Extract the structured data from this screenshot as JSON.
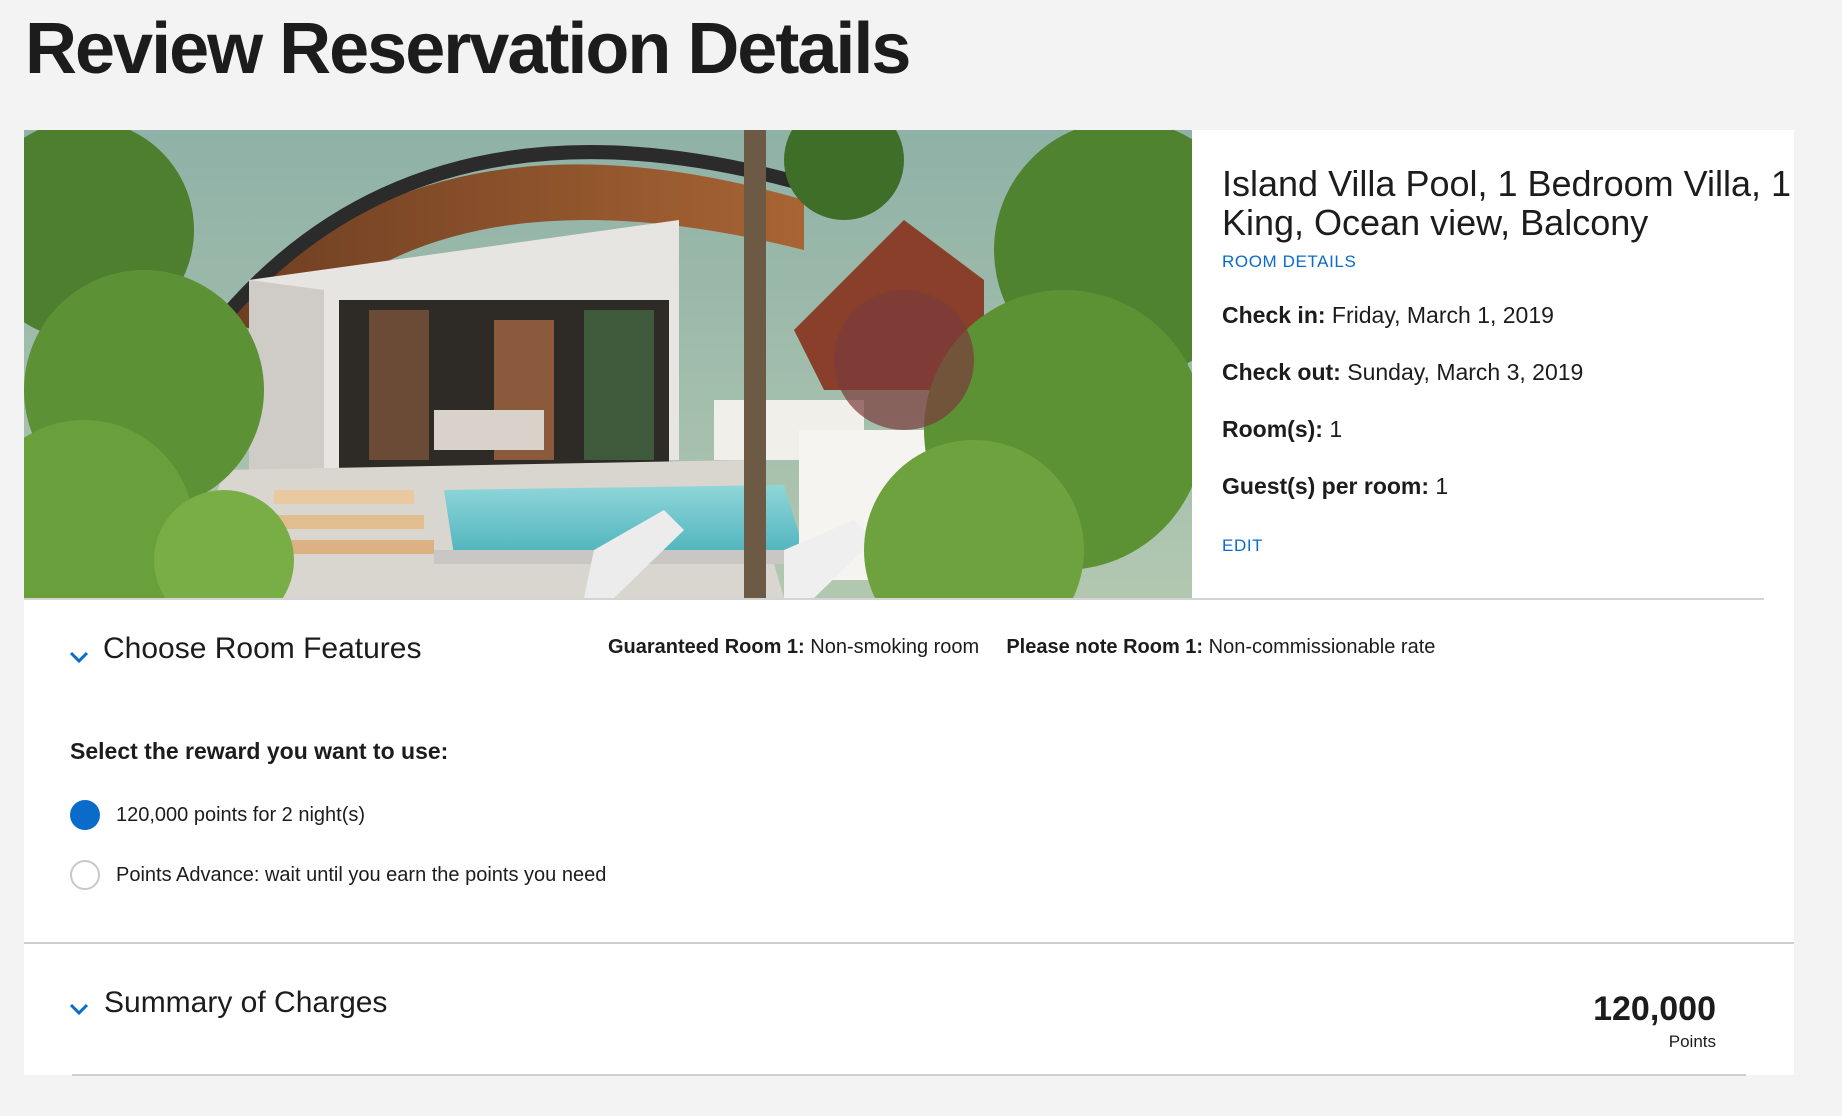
{
  "page": {
    "title": "Review Reservation Details"
  },
  "room": {
    "name": "Island Villa Pool, 1 Bedroom Villa, 1 King, Ocean view, Balcony",
    "room_details_link": "ROOM DETAILS",
    "check_in_label": "Check in:",
    "check_in_value": "Friday, March 1, 2019",
    "check_out_label": "Check out:",
    "check_out_value": "Sunday, March 3, 2019",
    "rooms_label": "Room(s):",
    "rooms_value": "1",
    "guests_label": "Guest(s) per room:",
    "guests_value": "1",
    "edit_link": "EDIT"
  },
  "features": {
    "title": "Choose Room Features",
    "guaranteed_label": "Guaranteed Room 1:",
    "guaranteed_value": "Non-smoking room",
    "note_label": "Please note Room 1:",
    "note_value": "Non-commissionable rate"
  },
  "reward": {
    "heading": "Select the reward you want to use:",
    "options": [
      {
        "label": "120,000 points for 2 night(s)",
        "selected": true
      },
      {
        "label": "Points Advance: wait until you earn the points you need",
        "selected": false
      }
    ]
  },
  "summary": {
    "title": "Summary of Charges",
    "points_value": "120,000",
    "points_unit": "Points"
  },
  "colors": {
    "accent": "#0b6bcb",
    "background": "#f3f3f3",
    "card": "#ffffff",
    "text": "#1c1c1c"
  },
  "icons": {
    "chevron": "chevron-down-icon",
    "radio_selected": "radio-selected-icon",
    "radio_unselected": "radio-unselected-icon"
  }
}
